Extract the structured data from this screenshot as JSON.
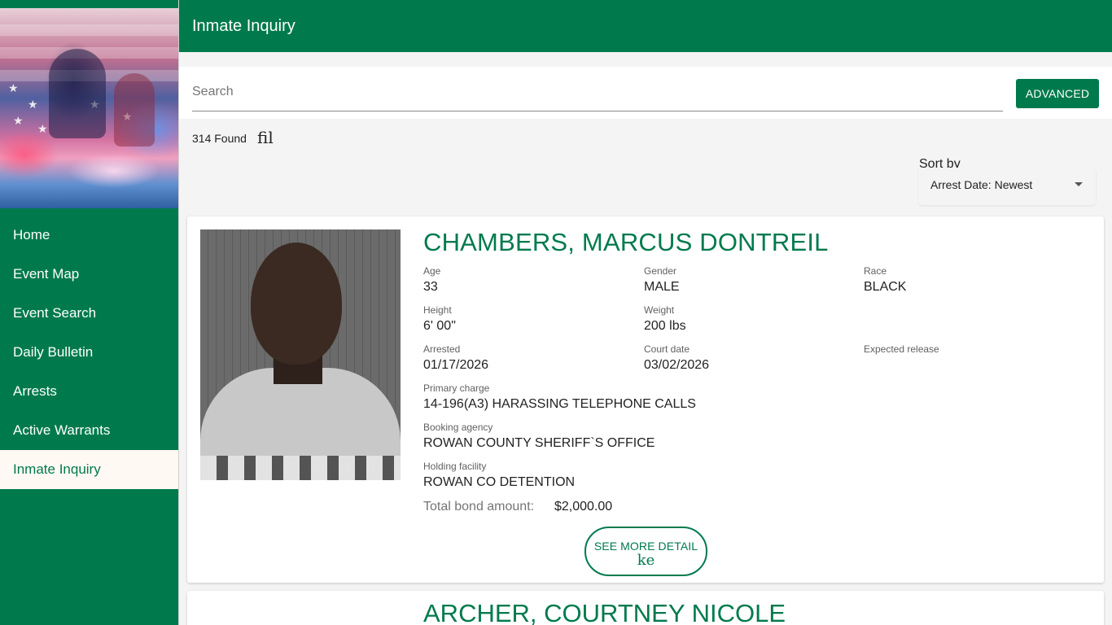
{
  "sidebar": {
    "items": [
      {
        "label": "Home"
      },
      {
        "label": "Event Map"
      },
      {
        "label": "Event Search"
      },
      {
        "label": "Daily Bulletin"
      },
      {
        "label": "Arrests"
      },
      {
        "label": "Active Warrants"
      },
      {
        "label": "Inmate Inquiry"
      }
    ],
    "active_index": 6
  },
  "header": {
    "title": "Inmate Inquiry"
  },
  "search": {
    "placeholder": "Search",
    "value": "",
    "advanced_label": "ADVANCED"
  },
  "results": {
    "count_text": "314 Found",
    "filter_icon_glyph": "fil"
  },
  "sort": {
    "label": "Sort by",
    "selected": "Arrest Date: Newest"
  },
  "colors": {
    "brand": "#007a4d",
    "active_bg": "#fff8f3"
  },
  "inmates": [
    {
      "name": "CHAMBERS, MARCUS DONTREIL",
      "age_label": "Age",
      "age": "33",
      "gender_label": "Gender",
      "gender": "MALE",
      "race_label": "Race",
      "race": "BLACK",
      "height_label": "Height",
      "height": "6' 00\"",
      "weight_label": "Weight",
      "weight": "200 lbs",
      "arrested_label": "Arrested",
      "arrested": "01/17/2026",
      "court_label": "Court date",
      "court": "03/02/2026",
      "release_label": "Expected release",
      "release": "",
      "charge_label": "Primary charge",
      "charge": "14-196(A3) HARASSING TELEPHONE CALLS",
      "agency_label": "Booking agency",
      "agency": "ROWAN COUNTY SHERIFF`S OFFICE",
      "facility_label": "Holding facility",
      "facility": "ROWAN CO DETENTION",
      "bond_label": "Total bond amount:",
      "bond": "$2,000.00",
      "more_label": "SEE MORE DETAIL",
      "more_icon_glyph": "ke"
    },
    {
      "name": "ARCHER, COURTNEY NICOLE"
    }
  ]
}
